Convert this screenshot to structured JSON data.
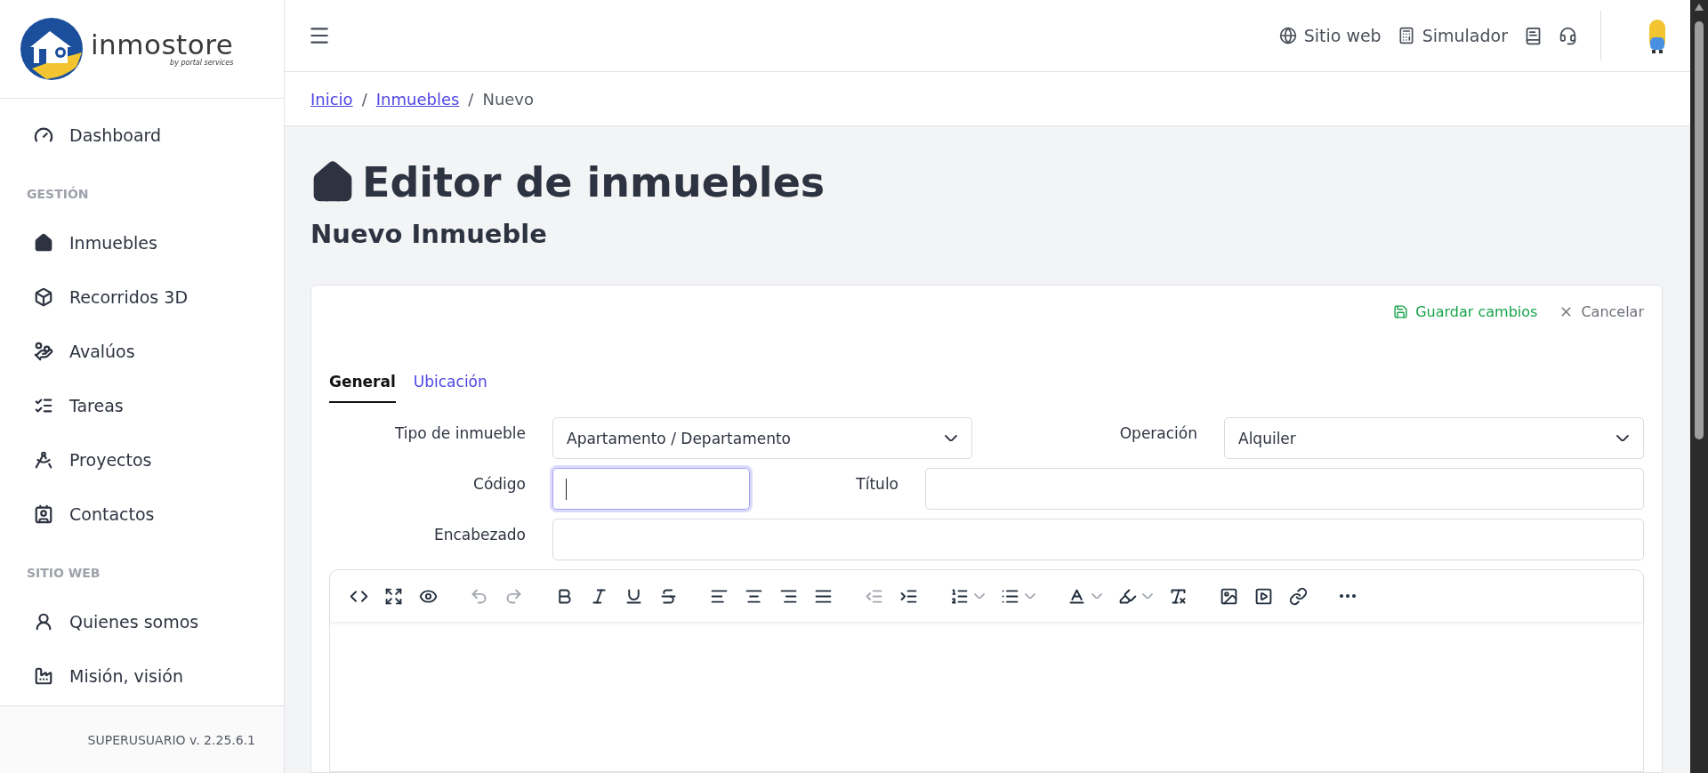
{
  "logo": {
    "name": "inmostore",
    "tagline": "by portal services"
  },
  "sidebar": {
    "sections": [
      {
        "items": [
          {
            "label": "Dashboard"
          }
        ]
      },
      {
        "heading": "GESTIÓN",
        "items": [
          {
            "label": "Inmuebles"
          },
          {
            "label": "Recorridos 3D"
          },
          {
            "label": "Avalúos"
          },
          {
            "label": "Tareas"
          },
          {
            "label": "Proyectos"
          },
          {
            "label": "Contactos"
          }
        ]
      },
      {
        "heading": "SITIO WEB",
        "items": [
          {
            "label": "Quienes somos"
          },
          {
            "label": "Misión, visión"
          }
        ]
      }
    ],
    "footer": "SUPERUSUARIO v. 2.25.6.1"
  },
  "header": {
    "links": [
      {
        "label": "Sitio web"
      },
      {
        "label": "Simulador"
      }
    ]
  },
  "breadcrumb": {
    "separator": "/",
    "items": [
      {
        "label": "Inicio",
        "link": true
      },
      {
        "label": "Inmuebles",
        "link": true
      },
      {
        "label": "Nuevo",
        "link": false
      }
    ]
  },
  "page": {
    "title": "Editor de inmuebles",
    "subtitle": "Nuevo Inmueble"
  },
  "card": {
    "actions": [
      {
        "kind": "save",
        "label": "Guardar cambios"
      },
      {
        "kind": "cancel",
        "label": "Cancelar"
      }
    ],
    "tabs": [
      {
        "label": "General",
        "selected": true
      },
      {
        "label": "Ubicación",
        "selected": false
      }
    ],
    "form": {
      "tipo": {
        "label": "Tipo de inmueble",
        "value": "Apartamento / Departamento"
      },
      "operacion": {
        "label": "Operación",
        "value": "Alquiler"
      },
      "codigo": {
        "label": "Código",
        "focused": true
      },
      "titulo": {
        "label": "Título",
        "focused": false
      },
      "encabezado": {
        "label": "Encabezado",
        "focused": false
      }
    },
    "toolbar": [
      [
        {
          "kind": "code",
          "disabled": false
        },
        {
          "kind": "fullscreen",
          "disabled": false
        },
        {
          "kind": "preview",
          "disabled": false
        }
      ],
      [
        {
          "kind": "undo",
          "disabled": true
        },
        {
          "kind": "redo",
          "disabled": true
        }
      ],
      [
        {
          "kind": "bold",
          "disabled": false
        },
        {
          "kind": "italic",
          "disabled": false
        },
        {
          "kind": "underline",
          "disabled": false
        },
        {
          "kind": "strike",
          "disabled": false
        }
      ],
      [
        {
          "kind": "align-left",
          "disabled": false
        },
        {
          "kind": "align-center",
          "disabled": false
        },
        {
          "kind": "align-right",
          "disabled": false
        },
        {
          "kind": "justify",
          "disabled": false
        }
      ],
      [
        {
          "kind": "outdent",
          "disabled": true
        },
        {
          "kind": "indent",
          "disabled": false
        }
      ],
      [
        {
          "kind": "ordered-list",
          "disabled": false
        },
        {
          "kind": "bullet-list",
          "disabled": false
        }
      ],
      [
        {
          "kind": "text-color",
          "disabled": false
        },
        {
          "kind": "highlight",
          "disabled": false
        },
        {
          "kind": "clear-format",
          "disabled": false
        }
      ],
      [
        {
          "kind": "image",
          "disabled": false
        },
        {
          "kind": "video",
          "disabled": false
        },
        {
          "kind": "link",
          "disabled": false
        }
      ],
      [
        {
          "kind": "more",
          "disabled": false
        }
      ]
    ]
  }
}
